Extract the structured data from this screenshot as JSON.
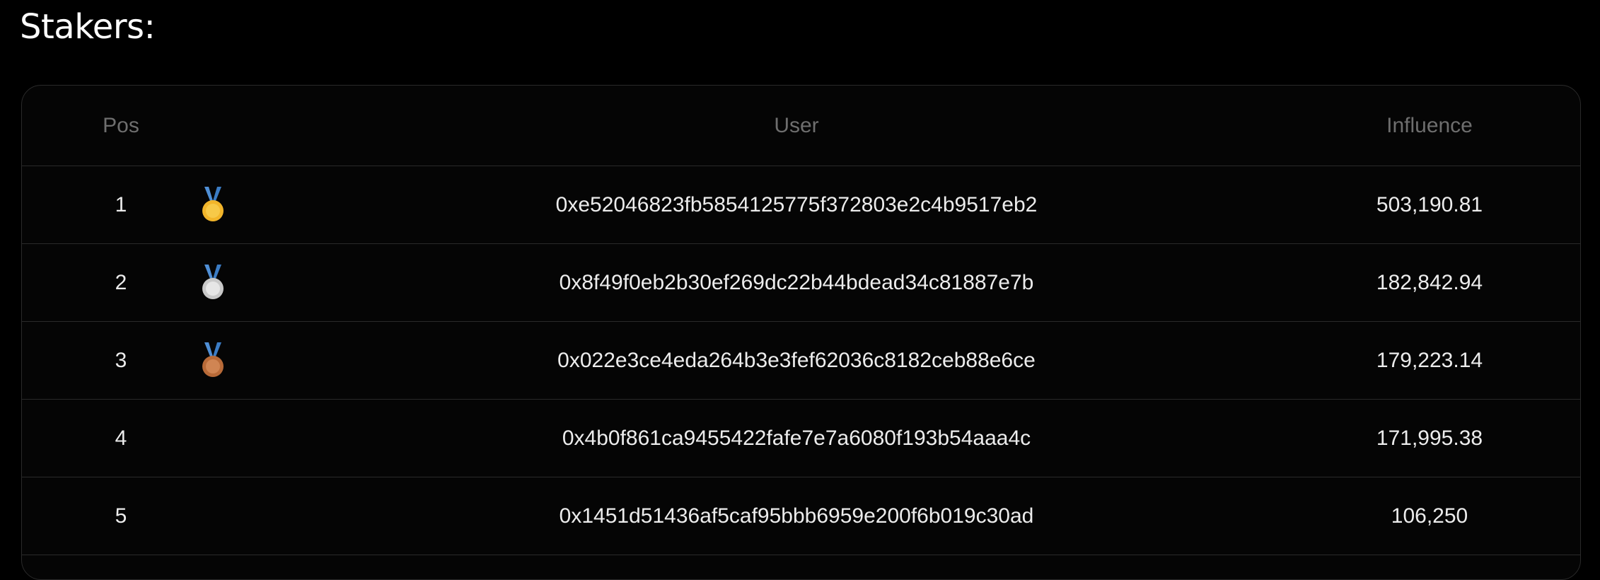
{
  "page": {
    "title": "Stakers:"
  },
  "table": {
    "headers": {
      "pos": "Pos",
      "user": "User",
      "influence": "Influence"
    },
    "rows": [
      {
        "pos": "1",
        "medal": "gold-medal-icon",
        "user": "0xe52046823fb5854125775f372803e2c4b9517eb2",
        "influence": "503,190.81"
      },
      {
        "pos": "2",
        "medal": "silver-medal-icon",
        "user": "0x8f49f0eb2b30ef269dc22b44bdead34c81887e7b",
        "influence": "182,842.94"
      },
      {
        "pos": "3",
        "medal": "bronze-medal-icon",
        "user": "0x022e3ce4eda264b3e3fef62036c8182ceb88e6ce",
        "influence": "179,223.14"
      },
      {
        "pos": "4",
        "medal": "",
        "user": "0x4b0f861ca9455422fafe7e7a6080f193b54aaa4c",
        "influence": "171,995.38"
      },
      {
        "pos": "5",
        "medal": "",
        "user": "0x1451d51436af5caf95bbb6959e200f6b019c30ad",
        "influence": "106,250"
      }
    ]
  },
  "colors": {
    "background": "#000000",
    "border": "#2a2a2a",
    "header_text": "#6e6e6e",
    "row_text": "#ececec",
    "gold": "#f2b52a",
    "silver": "#d4d4d4",
    "bronze": "#c77a45",
    "ribbon": "#4f8fd6"
  }
}
